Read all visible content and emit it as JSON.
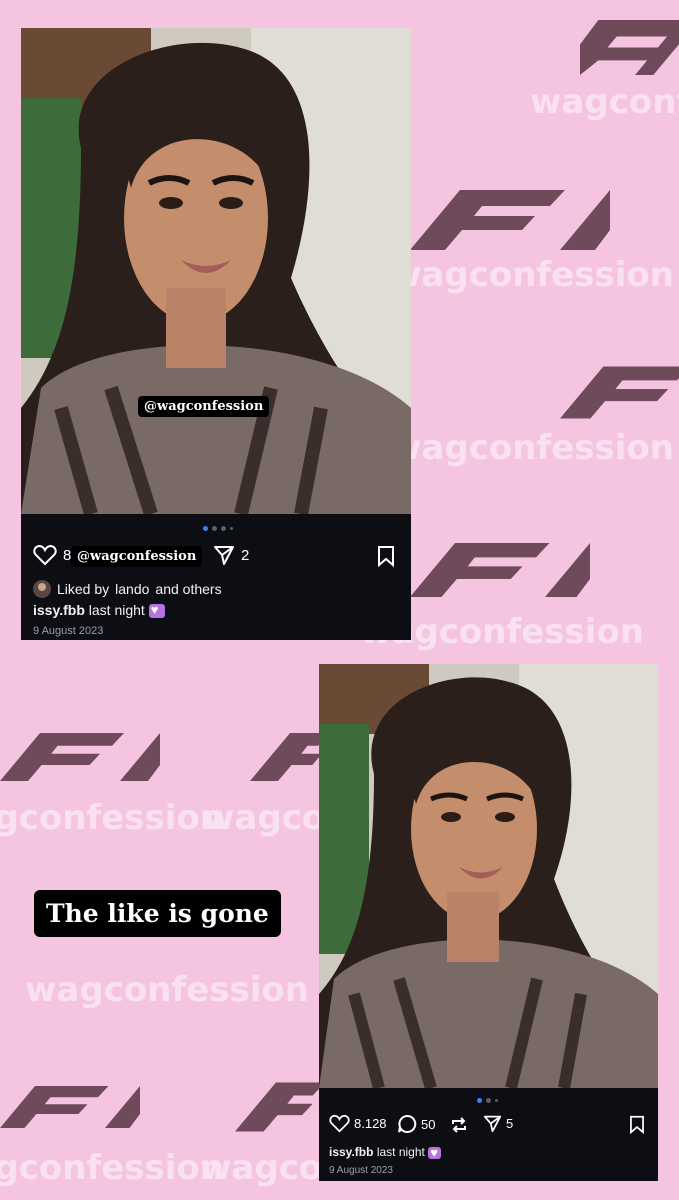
{
  "watermark_text": "wagconfession",
  "colors": {
    "background": "#f4c4e0",
    "watermark": "#fbe3f1",
    "f1_logo": "#6e4a5a",
    "post_bg": "#0c0e14",
    "dot_active": "#3b82f6"
  },
  "post_top": {
    "like_count": "8",
    "share_count": "2",
    "liked_by_prefix": "Liked by",
    "liked_by_user": "lando",
    "liked_by_suffix": "and others",
    "username": "issy.fbb",
    "caption": "last night",
    "date": "9 August 2023",
    "sticker": "@wagconfession",
    "overlay_sticker": "@wagconfession"
  },
  "post_bottom": {
    "like_count": "8.128",
    "comment_count": "50",
    "share_count": "5",
    "username": "issy.fbb",
    "caption": "last night",
    "date": "9 August 2023"
  },
  "caption_sticker": "The like is gone",
  "icons": [
    "heart-icon",
    "send-icon",
    "bookmark-icon",
    "comment-icon",
    "repost-icon"
  ]
}
